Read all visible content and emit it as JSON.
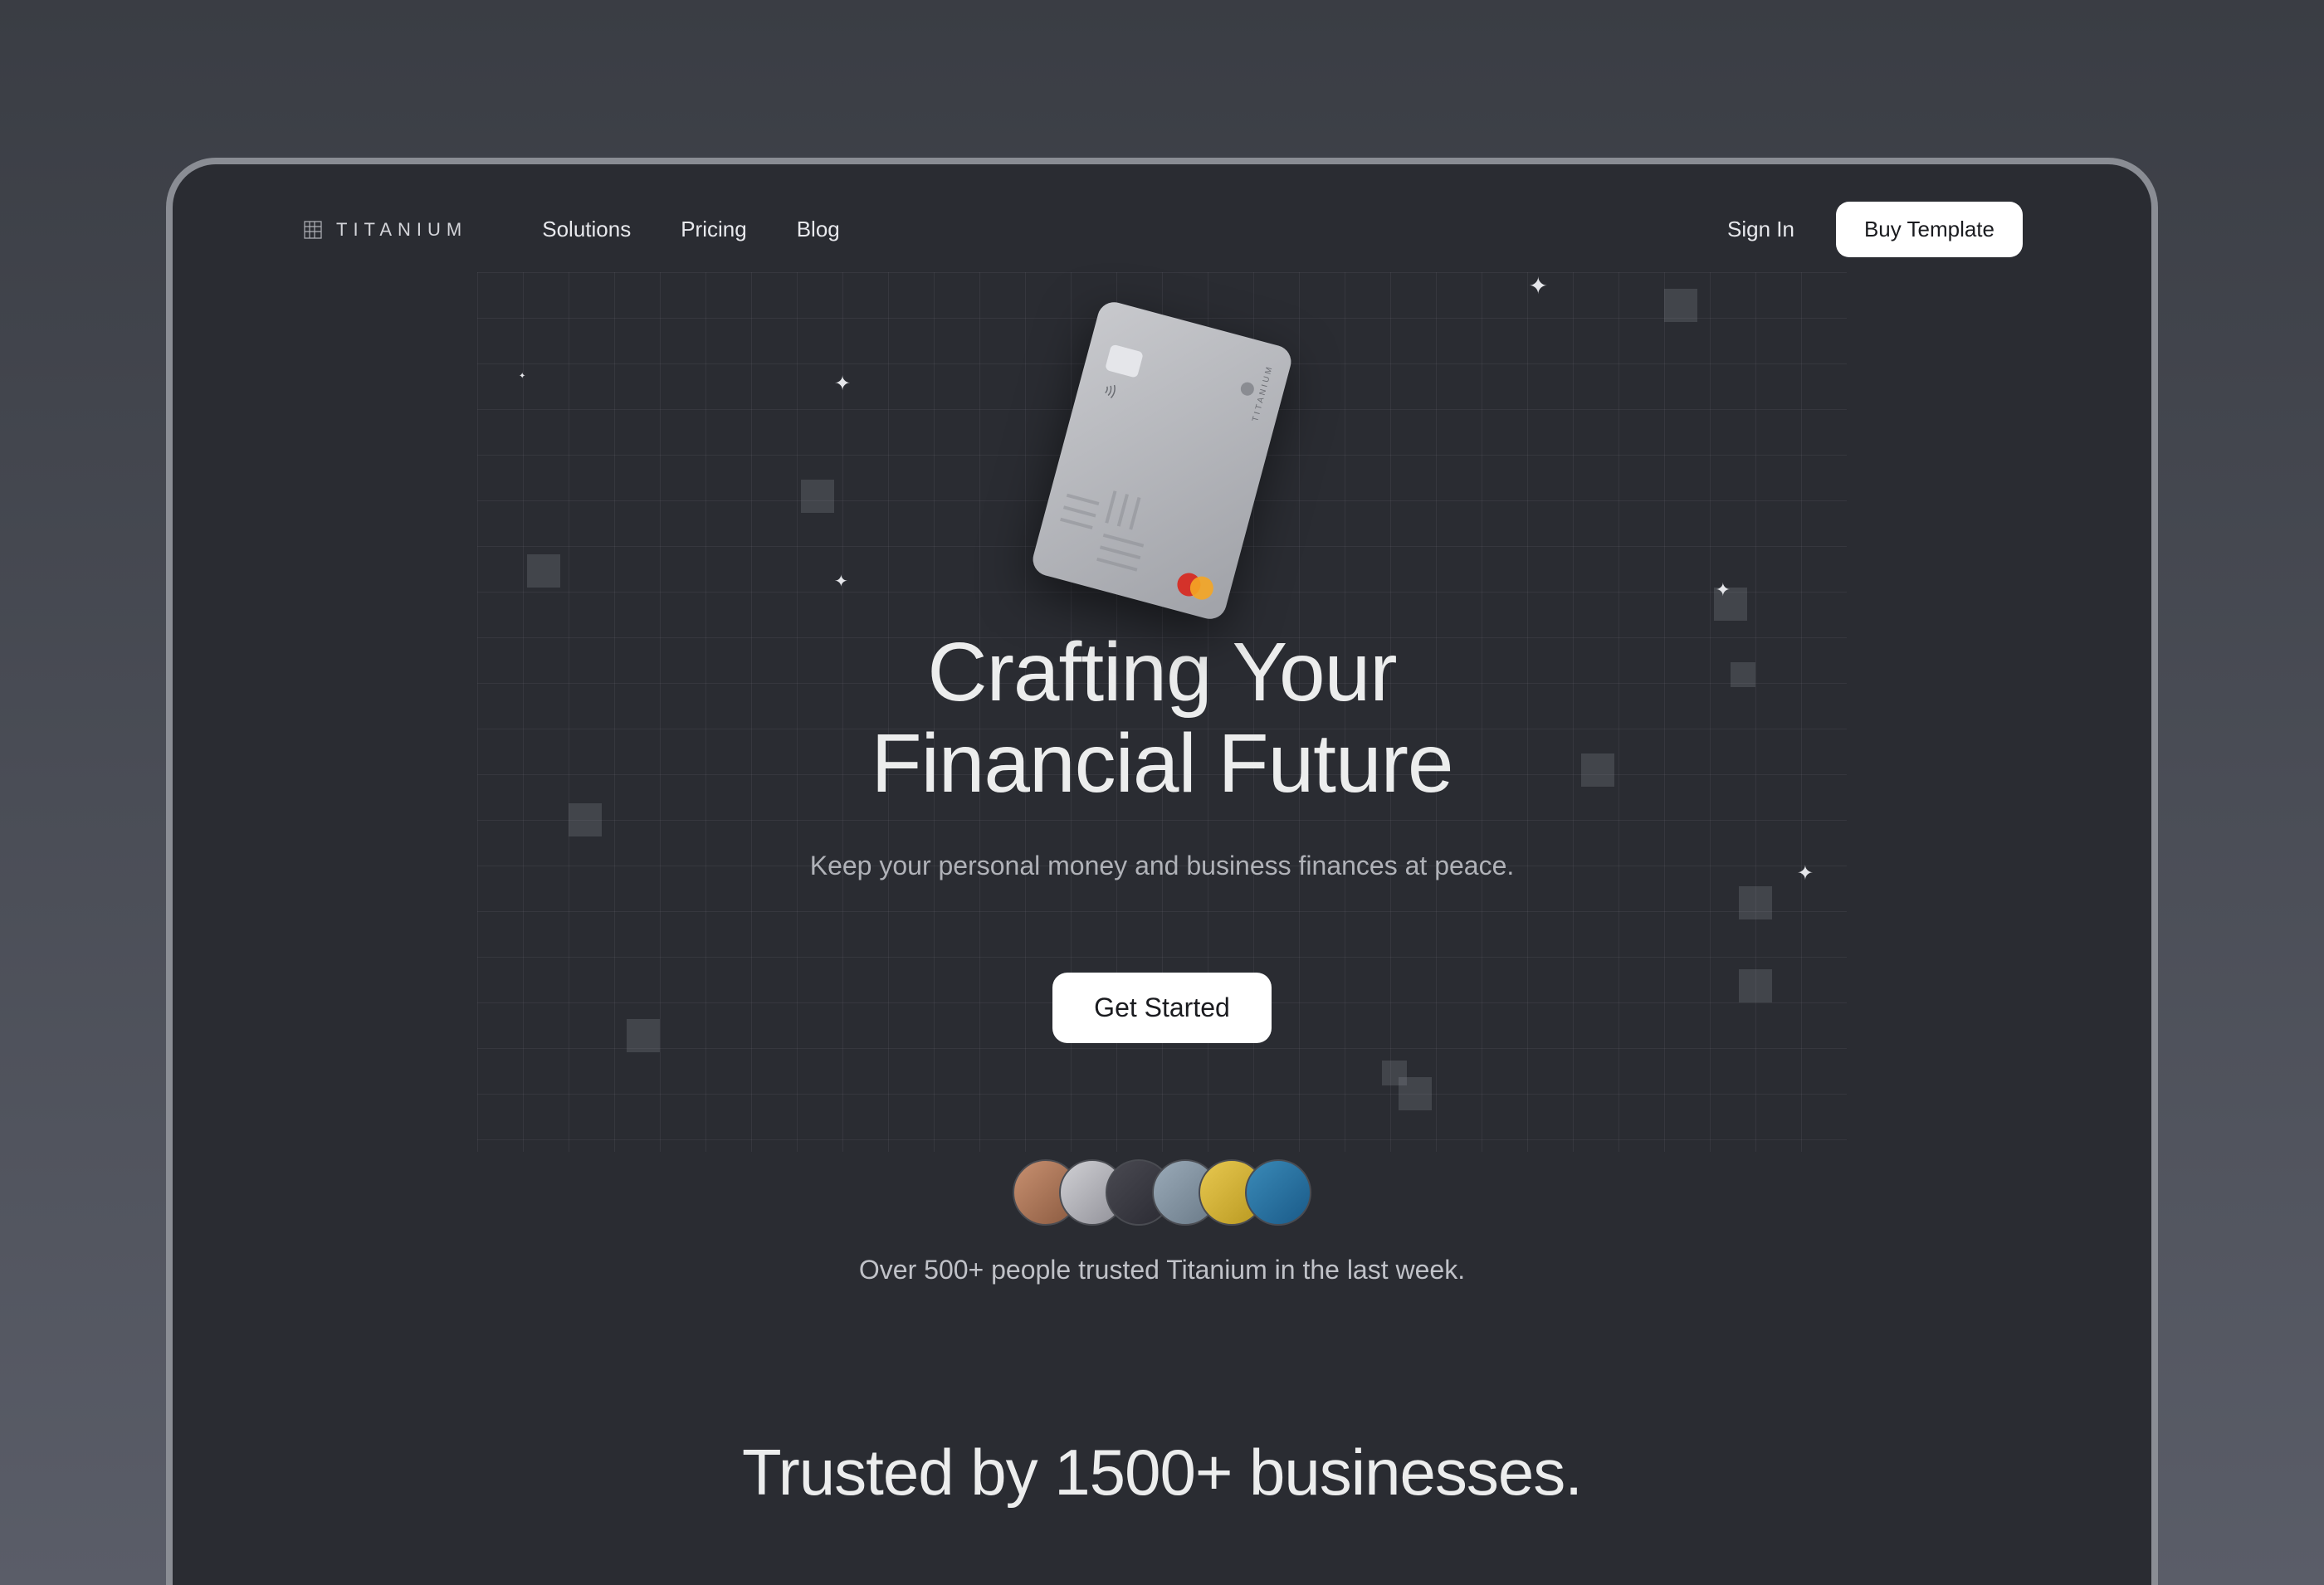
{
  "brand": {
    "name": "TITANIUM",
    "card_label": "TITANIUM"
  },
  "nav": {
    "solutions": "Solutions",
    "pricing": "Pricing",
    "blog": "Blog"
  },
  "header": {
    "sign_in": "Sign In",
    "buy_template": "Buy Template"
  },
  "hero": {
    "title_line1": "Crafting Your",
    "title_line2": "Financial Future",
    "subtitle": "Keep your personal money and business finances at peace.",
    "cta": "Get Started",
    "trust": "Over 500+ people trusted Titanium in the last week."
  },
  "section2": {
    "heading": "Trusted by 1500+ businesses."
  }
}
